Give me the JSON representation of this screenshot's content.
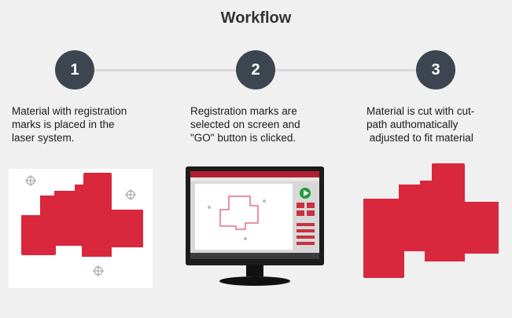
{
  "title": "Workflow",
  "steps": [
    {
      "number": "1",
      "lines": [
        "Material with registration",
        "marks is placed in the",
        "laser system."
      ]
    },
    {
      "number": "2",
      "lines": [
        "Registration marks are",
        "selected on screen and",
        "\"GO\" button is clicked."
      ]
    },
    {
      "number": "3",
      "lines": [
        "Material is cut with cut-",
        "path authomatically",
        " adjusted to fit material"
      ]
    }
  ],
  "colors": {
    "background": "#f0f0f0",
    "step_circle": "#3c4550",
    "material_red": "#d9283d",
    "connector": "#d9d9d9"
  },
  "icons": [
    "registration-mark-icon",
    "monitor-icon",
    "go-button-icon"
  ]
}
